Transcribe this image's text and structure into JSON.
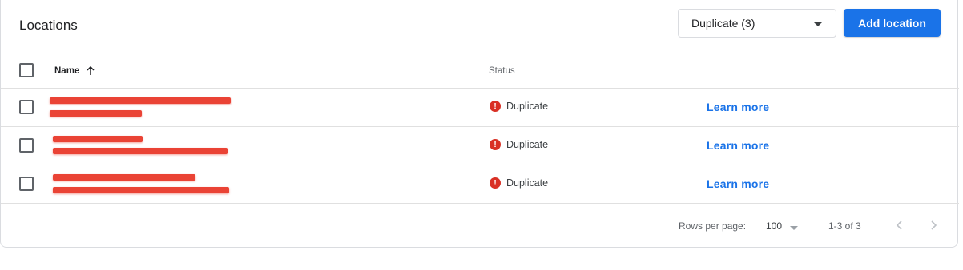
{
  "header": {
    "title": "Locations",
    "filter_value": "Duplicate (3)",
    "add_button": "Add location"
  },
  "table": {
    "columns": {
      "name": "Name",
      "status": "Status"
    },
    "sort": "ascending",
    "rows": [
      {
        "status": "Duplicate",
        "action": "Learn more"
      },
      {
        "status": "Duplicate",
        "action": "Learn more"
      },
      {
        "status": "Duplicate",
        "action": "Learn more"
      }
    ]
  },
  "footer": {
    "rows_per_page_label": "Rows per page:",
    "rows_per_page_value": "100",
    "range": "1-3 of 3"
  },
  "colors": {
    "primary": "#1a73e8",
    "error": "#d93025",
    "redaction": "#ea4335"
  },
  "icons": [
    "arrow-up-icon",
    "error-icon",
    "chevron-down-icon",
    "chevron-left-icon",
    "chevron-right-icon"
  ]
}
